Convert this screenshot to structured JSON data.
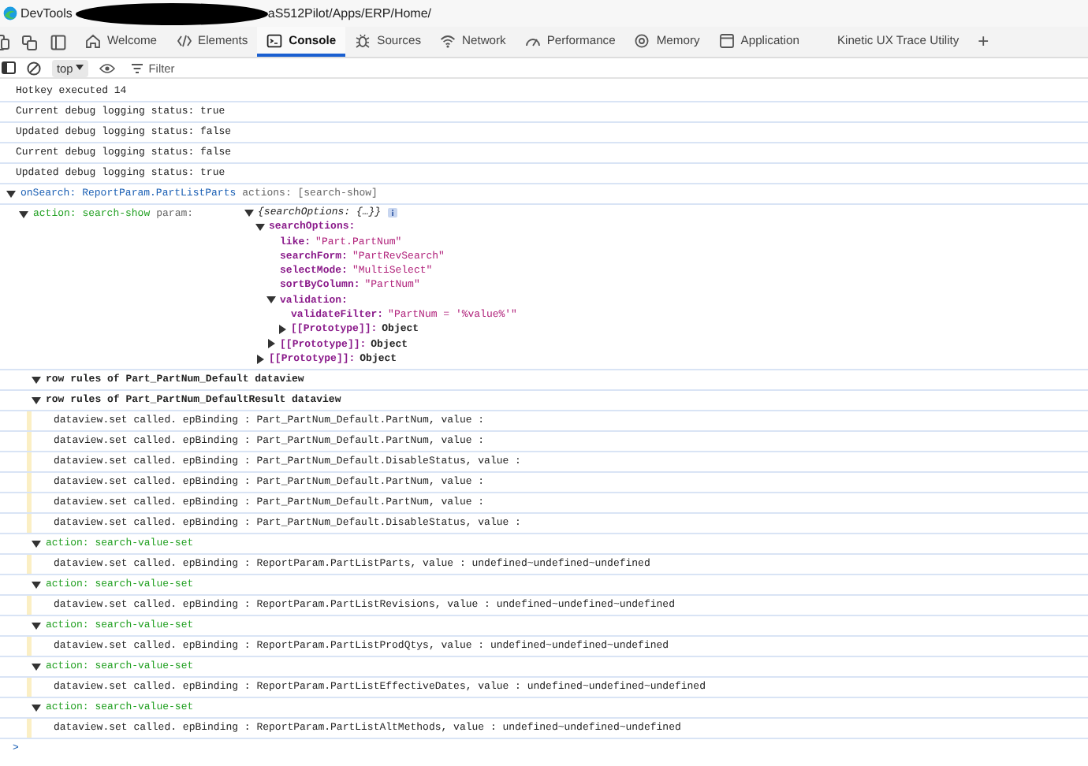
{
  "title_bar": {
    "title": "DevTools",
    "url": "aS512Pilot/Apps/ERP/Home/"
  },
  "tabs": [
    {
      "label": "Welcome",
      "selected": false
    },
    {
      "label": "Elements",
      "selected": false
    },
    {
      "label": "Console",
      "selected": true
    },
    {
      "label": "Sources",
      "selected": false
    },
    {
      "label": "Network",
      "selected": false
    },
    {
      "label": "Performance",
      "selected": false
    },
    {
      "label": "Memory",
      "selected": false
    },
    {
      "label": "Application",
      "selected": false
    },
    {
      "label": "Kinetic UX Trace Utility",
      "selected": false
    }
  ],
  "new_tab": "+",
  "toolbar": {
    "context": "top",
    "filter": {
      "placeholder": "Filter"
    }
  },
  "console": {
    "entries": [
      {
        "kind": "log",
        "text": "Hotkey executed 14",
        "flagged": false
      },
      {
        "kind": "log",
        "text": "Current debug logging status: true",
        "flagged": false
      },
      {
        "kind": "log",
        "text": "Updated debug logging status: false",
        "flagged": false
      },
      {
        "kind": "log",
        "text": "Current debug logging status: false",
        "flagged": false
      },
      {
        "kind": "log",
        "text": "Updated debug logging status: true",
        "flagged": false
      },
      {
        "kind": "group",
        "expanded": true,
        "parts": [
          {
            "text": "onSearch:",
            "kind": "link"
          },
          {
            "text": "ReportParam.PartListParts",
            "kind": "link"
          },
          {
            "text": "actions: [search-show]",
            "kind": "muted"
          }
        ],
        "children": [
          {
            "kind": "group",
            "expanded": true,
            "parts": [
              {
                "text": "action: search-show",
                "kind": "action"
              },
              {
                "text": "param:",
                "kind": "muted"
              }
            ],
            "object": {
              "summary": "{searchOptions: {…}}",
              "expanded": true,
              "properties": [
                {
                  "key": "searchOptions:",
                  "expanded": true,
                  "properties": [
                    {
                      "key": "like:",
                      "value": "\"Part.PartNum\"",
                      "kind": "string"
                    },
                    {
                      "key": "searchForm:",
                      "value": "\"PartRevSearch\"",
                      "kind": "string"
                    },
                    {
                      "key": "selectMode:",
                      "value": "\"MultiSelect\"",
                      "kind": "string"
                    },
                    {
                      "key": "sortByColumn:",
                      "value": "\"PartNum\"",
                      "kind": "string"
                    },
                    {
                      "key": "validation:",
                      "expanded": true,
                      "properties": [
                        {
                          "key": "validateFilter:",
                          "value": "\"PartNum = '%value%'\"",
                          "kind": "string"
                        },
                        {
                          "key": "[[Prototype]]:",
                          "value": "Object",
                          "kind": "object",
                          "expanded": false
                        }
                      ]
                    },
                    {
                      "key": "[[Prototype]]:",
                      "value": "Object",
                      "kind": "object",
                      "expanded": false
                    }
                  ]
                },
                {
                  "key": "[[Prototype]]:",
                  "value": "Object",
                  "kind": "object",
                  "expanded": false
                }
              ]
            },
            "children": [
              {
                "kind": "group",
                "expanded": true,
                "parts": [
                  {
                    "text": "row rules of Part_PartNum_Default dataview",
                    "kind": "heading"
                  }
                ]
              },
              {
                "kind": "group",
                "expanded": true,
                "parts": [
                  {
                    "text": "row rules of Part_PartNum_DefaultResult dataview",
                    "kind": "heading"
                  }
                ],
                "children": [
                  {
                    "kind": "log",
                    "text": "dataview.set called. epBinding : Part_PartNum_Default.PartNum, value :",
                    "flagged": true
                  },
                  {
                    "kind": "log",
                    "text": "dataview.set called. epBinding : Part_PartNum_Default.PartNum, value :",
                    "flagged": true
                  },
                  {
                    "kind": "log",
                    "text": "dataview.set called. epBinding : Part_PartNum_Default.DisableStatus, value :",
                    "flagged": true
                  },
                  {
                    "kind": "log",
                    "text": "dataview.set called. epBinding : Part_PartNum_Default.PartNum, value :",
                    "flagged": true
                  },
                  {
                    "kind": "log",
                    "text": "dataview.set called. epBinding : Part_PartNum_Default.PartNum, value :",
                    "flagged": true
                  },
                  {
                    "kind": "log",
                    "text": "dataview.set called. epBinding : Part_PartNum_Default.DisableStatus, value :",
                    "flagged": true
                  }
                ]
              },
              {
                "kind": "group",
                "expanded": true,
                "parts": [
                  {
                    "text": "action: search-value-set",
                    "kind": "action"
                  }
                ],
                "children": [
                  {
                    "kind": "log",
                    "text": "dataview.set called. epBinding : ReportParam.PartListParts, value : undefined~undefined~undefined",
                    "flagged": true
                  }
                ]
              },
              {
                "kind": "group",
                "expanded": true,
                "parts": [
                  {
                    "text": "action: search-value-set",
                    "kind": "action"
                  }
                ],
                "children": [
                  {
                    "kind": "log",
                    "text": "dataview.set called. epBinding : ReportParam.PartListRevisions, value : undefined~undefined~undefined",
                    "flagged": true
                  }
                ]
              },
              {
                "kind": "group",
                "expanded": true,
                "parts": [
                  {
                    "text": "action: search-value-set",
                    "kind": "action"
                  }
                ],
                "children": [
                  {
                    "kind": "log",
                    "text": "dataview.set called. epBinding : ReportParam.PartListProdQtys, value : undefined~undefined~undefined",
                    "flagged": true
                  }
                ]
              },
              {
                "kind": "group",
                "expanded": true,
                "parts": [
                  {
                    "text": "action: search-value-set",
                    "kind": "action"
                  }
                ],
                "children": [
                  {
                    "kind": "log",
                    "text": "dataview.set called. epBinding : ReportParam.PartListEffectiveDates, value : undefined~undefined~undefined",
                    "flagged": true
                  }
                ]
              },
              {
                "kind": "group",
                "expanded": true,
                "parts": [
                  {
                    "text": "action: search-value-set",
                    "kind": "action"
                  }
                ],
                "children": [
                  {
                    "kind": "log",
                    "text": "dataview.set called. epBinding : ReportParam.PartListAltMethods, value : undefined~undefined~undefined",
                    "flagged": true
                  }
                ]
              }
            ]
          }
        ]
      }
    ],
    "prompt": ">"
  }
}
